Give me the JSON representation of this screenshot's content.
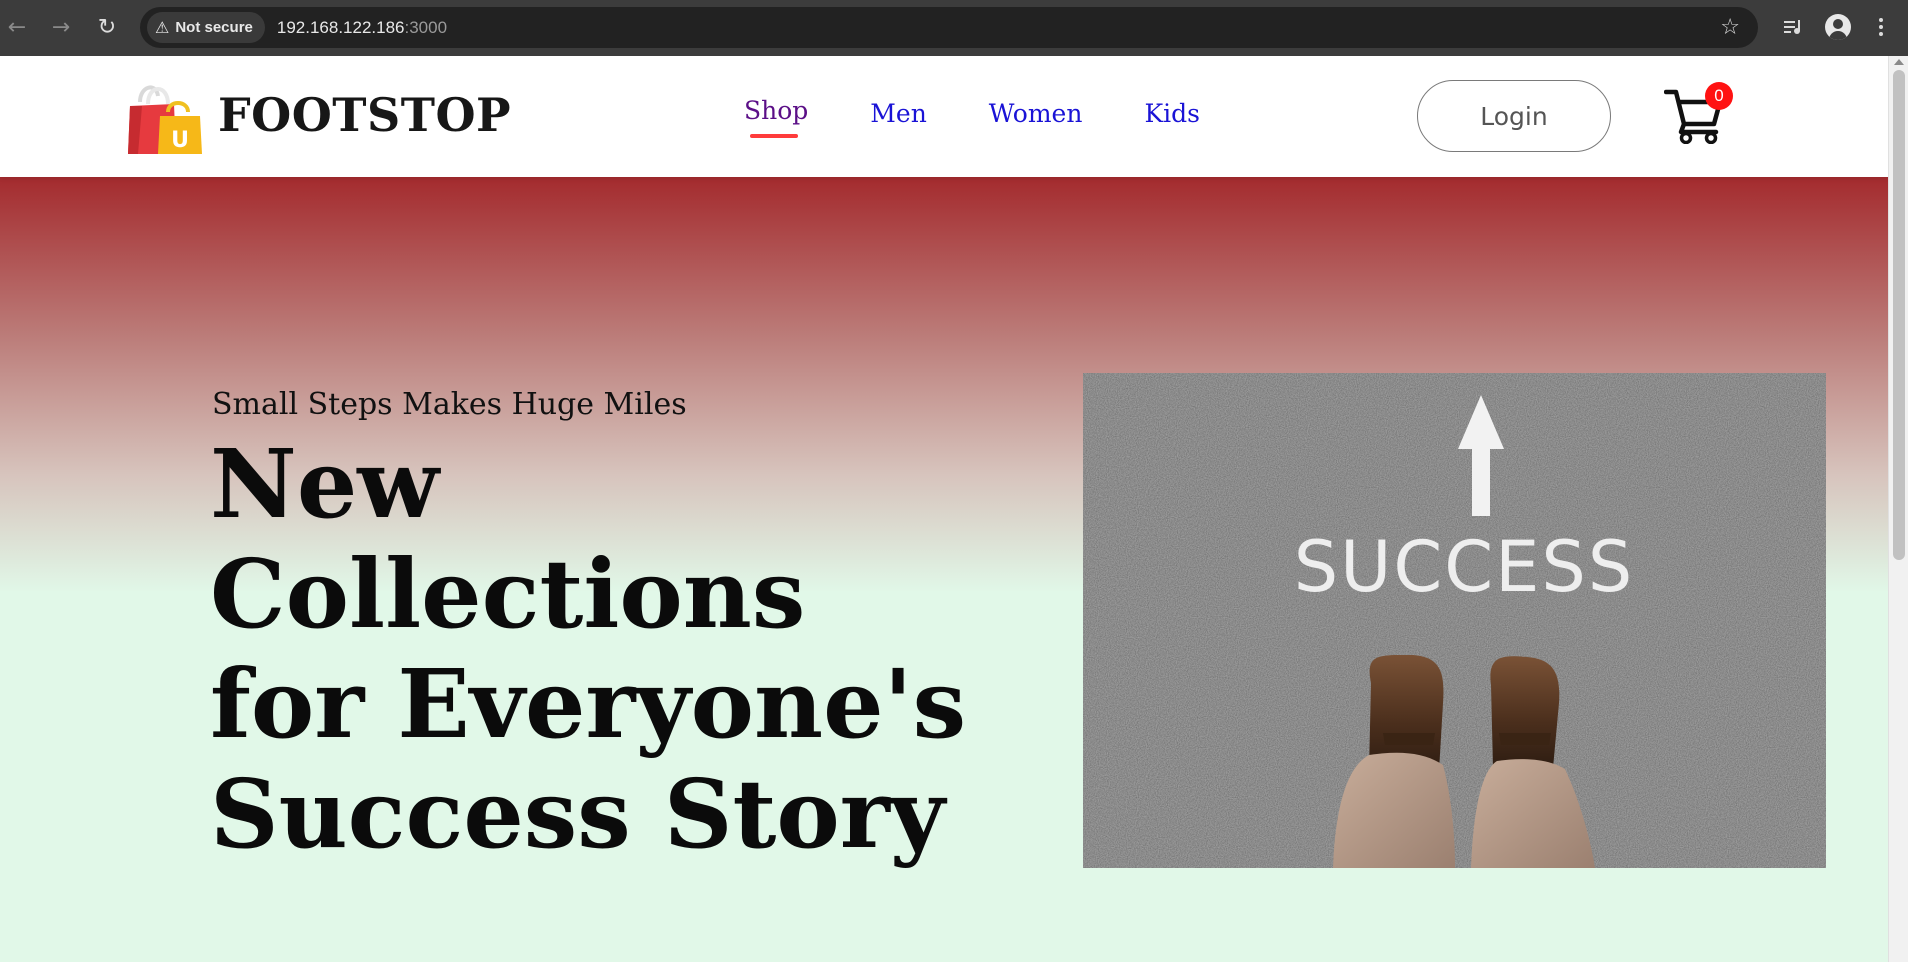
{
  "browser": {
    "security_label": "Not secure",
    "url_host": "192.168.122.186",
    "url_port": ":3000",
    "icons": [
      "back-arrow-icon",
      "forward-arrow-icon",
      "reload-icon",
      "warning-icon",
      "star-icon",
      "media-queue-icon",
      "profile-icon",
      "more-menu-icon"
    ]
  },
  "navbar": {
    "brand": "FOOTSTOP",
    "logo_letter": "U",
    "menu": [
      {
        "label": "Shop",
        "active": true
      },
      {
        "label": "Men",
        "active": false
      },
      {
        "label": "Women",
        "active": false
      },
      {
        "label": "Kids",
        "active": false
      }
    ],
    "login_label": "Login",
    "cart_count": "0"
  },
  "hero": {
    "tagline": "Small Steps Makes Huge Miles",
    "headline_lines": [
      "New",
      "Collections",
      "for Everyone's",
      "Success Story"
    ],
    "image_text": "SUCCESS"
  },
  "colors": {
    "link": "#1a13d6",
    "link_active": "#5b0f87",
    "underline": "#ff3b3b",
    "badge": "#ff1212",
    "hero_top": "#a42b2e",
    "hero_bottom": "#e1f8e8"
  }
}
